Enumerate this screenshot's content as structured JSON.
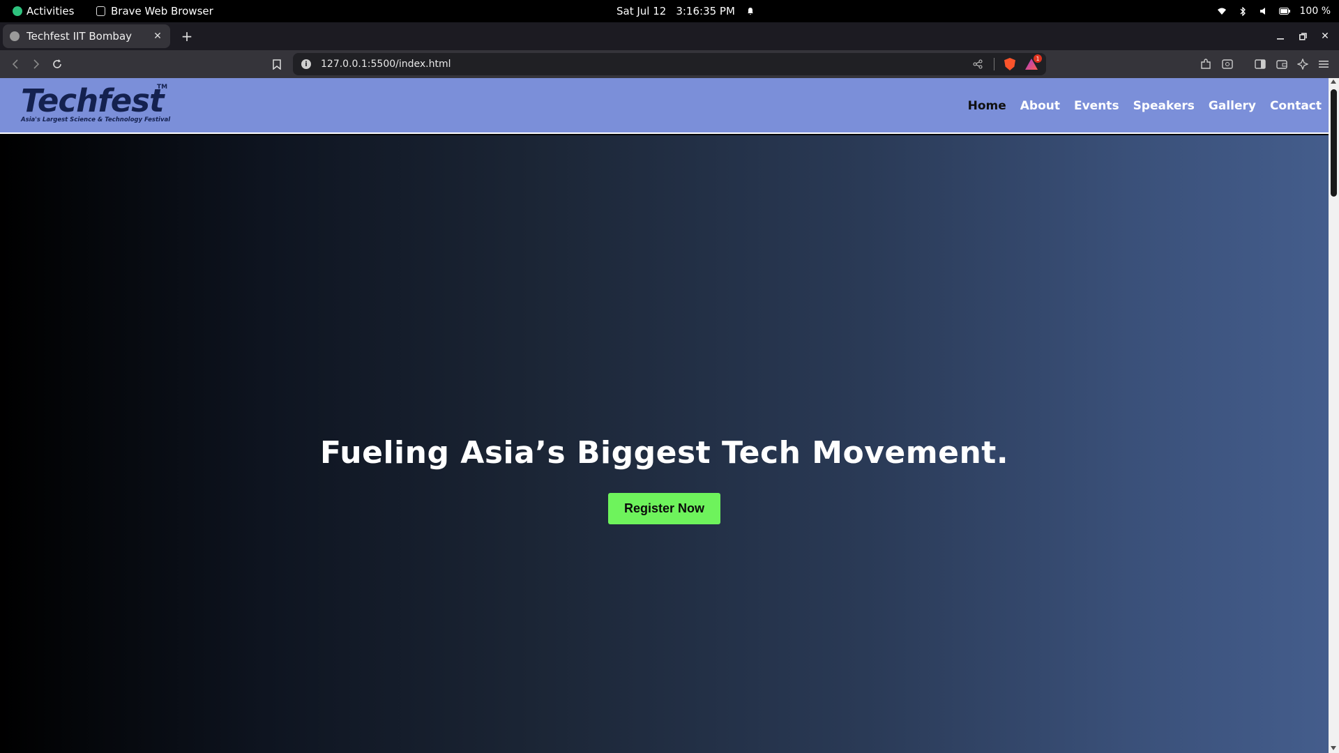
{
  "system_bar": {
    "activities": "Activities",
    "app_name": "Brave Web Browser",
    "date": "Sat Jul 12",
    "time": "3:16:35 PM",
    "battery": "100 %"
  },
  "browser": {
    "tab_title": "Techfest IIT Bombay",
    "url": "127.0.0.1:5500/index.html",
    "rewards_badge": "1"
  },
  "site": {
    "logo_text": "Techfest",
    "logo_tm": "TM",
    "logo_tagline": "Asia's Largest Science & Technology Festival",
    "nav": [
      "Home",
      "About",
      "Events",
      "Speakers",
      "Gallery",
      "Contact"
    ],
    "active_nav": "Home",
    "colors": {
      "header_bg": "#7b8fd9",
      "cta_bg": "#6ef35c",
      "logo": "#14214f"
    }
  },
  "hero": {
    "headline": "Fueling Asia’s Biggest Tech Movement.",
    "cta_label": "Register Now"
  }
}
